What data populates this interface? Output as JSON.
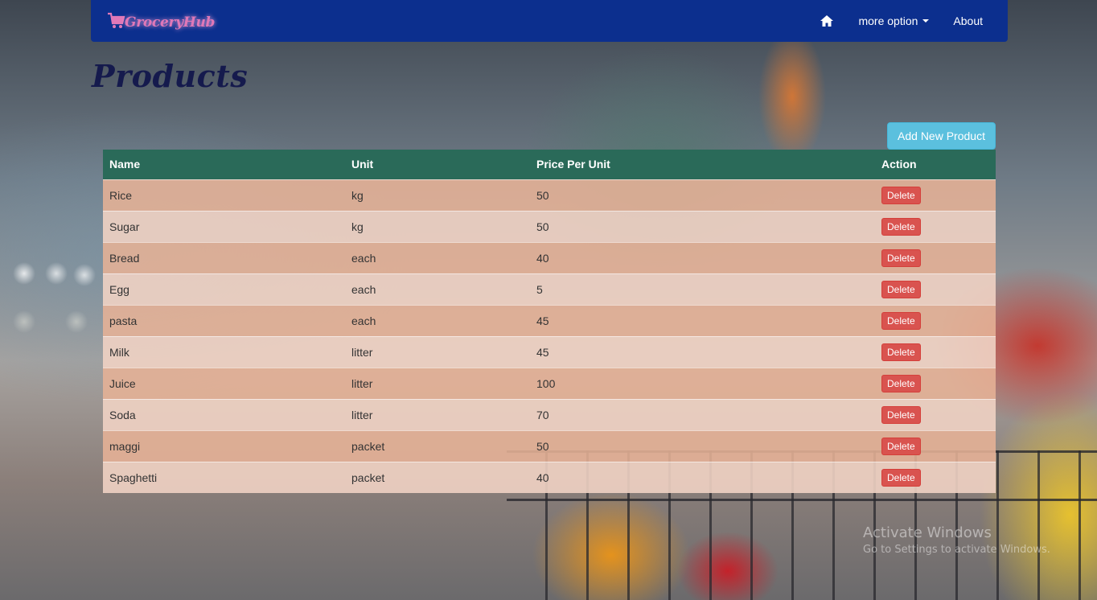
{
  "navbar": {
    "brand": "GroceryHub",
    "brand_icon": "shopping-cart-icon",
    "home_icon": "home-icon",
    "more_option": "more option",
    "about": "About"
  },
  "page": {
    "title": "Products",
    "add_button": "Add New Product"
  },
  "table": {
    "headers": [
      "Name",
      "Unit",
      "Price Per Unit",
      "Action"
    ],
    "rows": [
      {
        "name": "Rice",
        "unit": "kg",
        "price": "50",
        "action": "Delete"
      },
      {
        "name": "Sugar",
        "unit": "kg",
        "price": "50",
        "action": "Delete"
      },
      {
        "name": "Bread",
        "unit": "each",
        "price": "40",
        "action": "Delete"
      },
      {
        "name": "Egg",
        "unit": "each",
        "price": "5",
        "action": "Delete"
      },
      {
        "name": "pasta",
        "unit": "each",
        "price": "45",
        "action": "Delete"
      },
      {
        "name": "Milk",
        "unit": "litter",
        "price": "45",
        "action": "Delete"
      },
      {
        "name": "Juice",
        "unit": "litter",
        "price": "100",
        "action": "Delete"
      },
      {
        "name": "Soda",
        "unit": "litter",
        "price": "70",
        "action": "Delete"
      },
      {
        "name": "maggi",
        "unit": "packet",
        "price": "50",
        "action": "Delete"
      },
      {
        "name": "Spaghetti",
        "unit": "packet",
        "price": "40",
        "action": "Delete"
      }
    ]
  },
  "watermark": {
    "line1": "Activate Windows",
    "line2": "Go to Settings to activate Windows."
  },
  "colors": {
    "navbar": "#0c2f8e",
    "table_header": "#2a6a59",
    "add_button": "#5bc0de",
    "delete_button": "#d9534f",
    "title": "#151a4d"
  }
}
